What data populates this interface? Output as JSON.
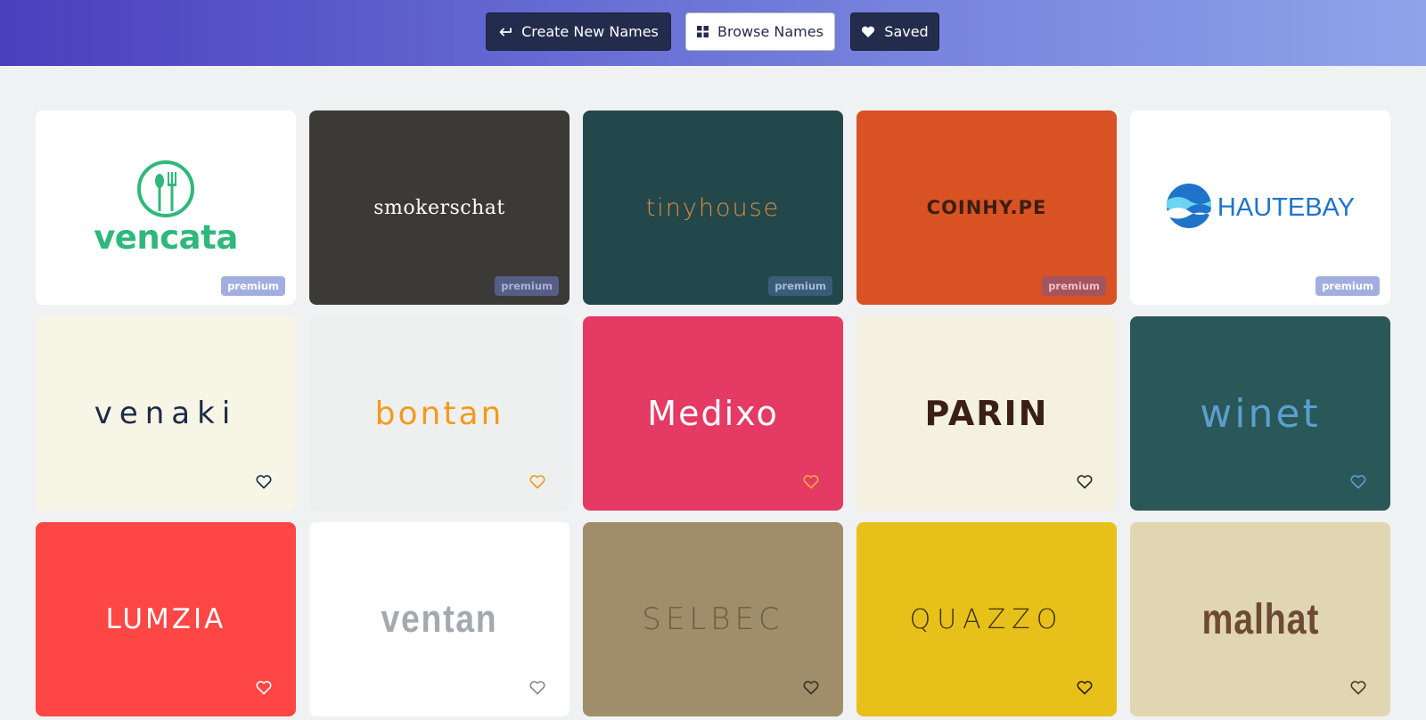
{
  "nav": {
    "create_label": "Create New Names",
    "create_icon": "return-arrow-icon",
    "browse_label": "Browse Names",
    "browse_icon": "grid-icon",
    "saved_label": "Saved",
    "saved_icon": "heart-icon"
  },
  "colors": {
    "header_start": "#4a3fbd",
    "header_end": "#8fa3ea",
    "page_bg": "#f0f1f3",
    "button_dark": "#232c4c"
  },
  "names": [
    {
      "name": "vencata",
      "bg": "#ffffff",
      "color": "#2fb87b",
      "badge": "premium",
      "icon": "fork-spoon-icon"
    },
    {
      "name": "smokerschat",
      "bg": "#3b3a36",
      "color": "#ffffff",
      "badge": "premium",
      "icon": "smoke-ring-icon"
    },
    {
      "name": "tinyhouse",
      "bg": "#23484b",
      "color": "#e08a3c",
      "badge": "premium",
      "icon": "house-icon"
    },
    {
      "name": "COINHY.PE",
      "bg": "#d95224",
      "color": "#3a1f12",
      "badge": "premium",
      "icon": "coin-icon"
    },
    {
      "name": "HAUTEBAY",
      "bg": "#ffffff",
      "color": "#1f74c9",
      "badge": "premium",
      "icon": "wave-globe-icon"
    },
    {
      "name": "venaki",
      "bg": "#f7f5e6",
      "color": "#1d2a46",
      "heart": "#1d2a46"
    },
    {
      "name": "bontan",
      "bg": "#eef0f0",
      "color": "#f39a1d",
      "heart": "#f39a1d"
    },
    {
      "name": "Medixo",
      "bg": "#e43a63",
      "color": "#ffffff",
      "heart": "#f3a83c"
    },
    {
      "name": "PARIN",
      "bg": "#f4f1e0",
      "color": "#3a1f18",
      "accent": "#e0542f",
      "heart": "#2a2a2a"
    },
    {
      "name": "winet",
      "bg": "#2a5757",
      "color": "#5a9fd0",
      "heart": "#5a9fd0"
    },
    {
      "name": "LUMZIA",
      "bg": "#fe4645",
      "color": "#ffffff",
      "heart": "#ffffff"
    },
    {
      "name": "ventan",
      "bg": "#ffffff",
      "color": "#a3a9ae",
      "heart": "#888888"
    },
    {
      "name": "SELBEC",
      "bg": "#9f8e69",
      "color": "#6a5d42",
      "heart": "#3a3325"
    },
    {
      "name": "QUAZZO",
      "bg": "#e8c01a",
      "color": "#3b3210",
      "heart": "#2a2410"
    },
    {
      "name": "malhat",
      "bg": "#e0d6b2",
      "color": "#6e4a35",
      "heart": "#4a3a2a"
    }
  ]
}
